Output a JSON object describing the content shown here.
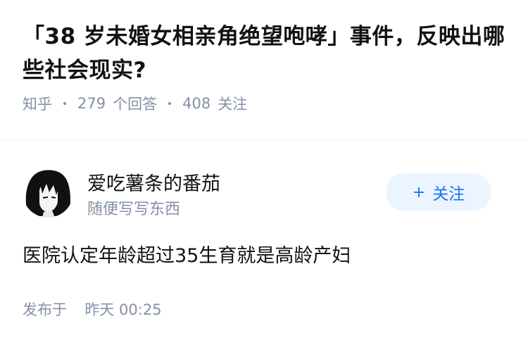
{
  "question": {
    "title": "「38 岁未婚女相亲角绝望咆哮」事件，反映出哪些社会现实?",
    "source": "知乎",
    "answer_count": "279",
    "answer_count_label": "个回答",
    "follower_count": "408",
    "follower_count_label": "关注"
  },
  "answer": {
    "author": {
      "name": "爱吃薯条的番茄",
      "bio": "随便写写东西",
      "avatar_icon": "anime-character-avatar"
    },
    "follow_button": {
      "icon": "plus-icon",
      "plus": "+",
      "label": "关注",
      "background": "#ebf5ff",
      "text_color": "#1772f6"
    },
    "content": "医院认定年龄超过35生育就是高龄产妇",
    "published_label": "发布于",
    "published_time": "昨天 00:25"
  },
  "colors": {
    "title": "#121212",
    "meta": "#8590a6",
    "divider": "#f0f2f7"
  }
}
